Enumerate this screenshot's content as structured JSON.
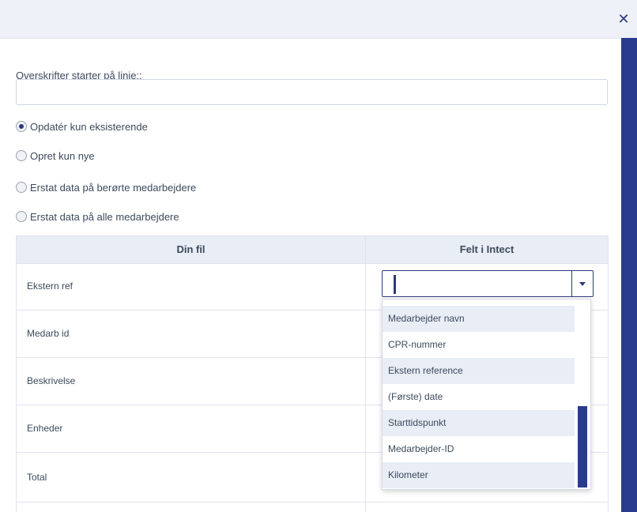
{
  "dialog": {
    "close_icon": "close-icon",
    "close_symbol": "✕"
  },
  "form": {
    "header_label": "Overskrifter starter på linie::",
    "header_input_value": "",
    "radio_options": [
      {
        "label": "Opdatér kun eksisterende",
        "checked": true
      },
      {
        "label": "Opret kun nye",
        "checked": false
      },
      {
        "label": "Erstat data på berørte medarbejdere",
        "checked": false
      },
      {
        "label": "Erstat data på alle medarbejdere",
        "checked": false
      }
    ]
  },
  "table": {
    "columns": [
      "Din fil",
      "Felt i Intect"
    ],
    "rows": [
      "Ekstern ref",
      "Medarb id",
      "Beskrivelse",
      "Enheder",
      "Total"
    ]
  },
  "mapping_select": {
    "value": "",
    "options": [
      "Medarbejder navn",
      "CPR-nummer",
      "Ekstern reference",
      "(Første) date",
      "Starttidspunkt",
      "Medarbejder-ID",
      "Kilometer"
    ]
  },
  "colors": {
    "accent": "#283b8f",
    "topbar": "#eef0f8",
    "row_shade": "#e9edf6"
  }
}
